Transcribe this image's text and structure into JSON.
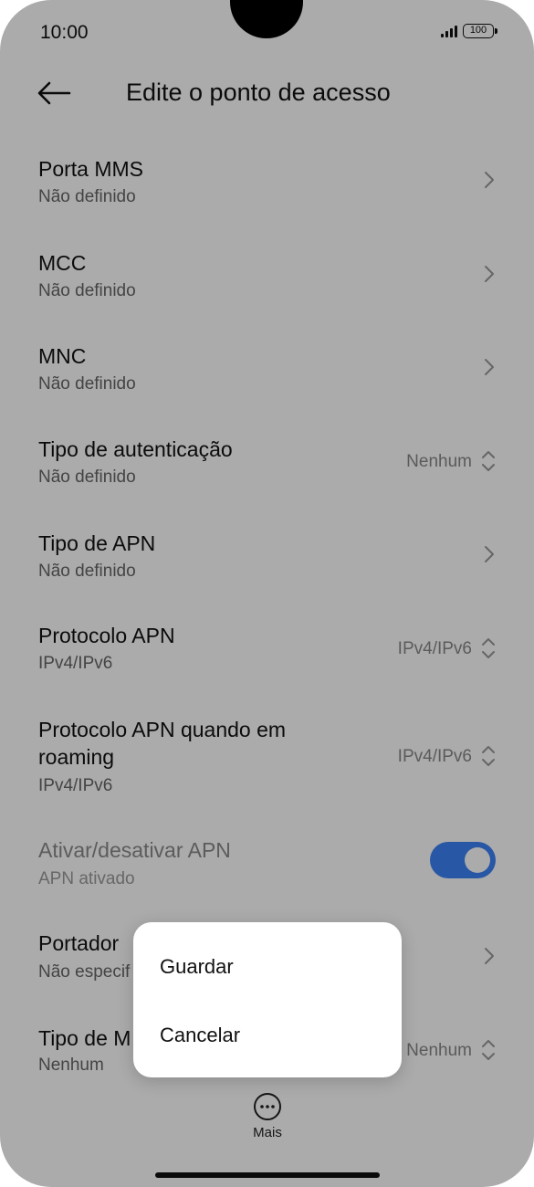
{
  "status_bar": {
    "time": "10:00",
    "battery": "100"
  },
  "header": {
    "title": "Edite o ponto de acesso"
  },
  "settings": {
    "items": [
      {
        "title": "Porta MMS",
        "subtitle": "Não definido"
      },
      {
        "title": "MCC",
        "subtitle": "Não definido"
      },
      {
        "title": "MNC",
        "subtitle": "Não definido"
      },
      {
        "title": "Tipo de autenticação",
        "subtitle": "Não definido",
        "value": "Nenhum"
      },
      {
        "title": "Tipo de APN",
        "subtitle": "Não definido"
      },
      {
        "title": "Protocolo APN",
        "subtitle": "IPv4/IPv6",
        "value": "IPv4/IPv6"
      },
      {
        "title": "Protocolo APN quando em roaming",
        "title_line1": "Protocolo APN quando em",
        "title_line2": "roaming",
        "subtitle": "IPv4/IPv6",
        "value": "IPv4/IPv6"
      },
      {
        "title": "Ativar/desativar APN",
        "subtitle": "APN ativado",
        "toggle": "on",
        "enabled": false
      },
      {
        "title": "Portador",
        "subtitle": "Não especif"
      },
      {
        "title": "Tipo de M",
        "subtitle": "Nenhum",
        "value": "Nenhum"
      }
    ]
  },
  "popup_menu": {
    "items": [
      "Guardar",
      "Cancelar"
    ]
  },
  "bottom_bar": {
    "more_label": "Mais"
  },
  "colors": {
    "accent": "#3b82f6",
    "overlay": "rgba(0,0,0,0.33)"
  },
  "icons": {
    "back": "back-arrow-icon",
    "chevron": "chevron-right-icon",
    "updown": "up-down-chevron-icon",
    "more": "more-dots-icon"
  }
}
